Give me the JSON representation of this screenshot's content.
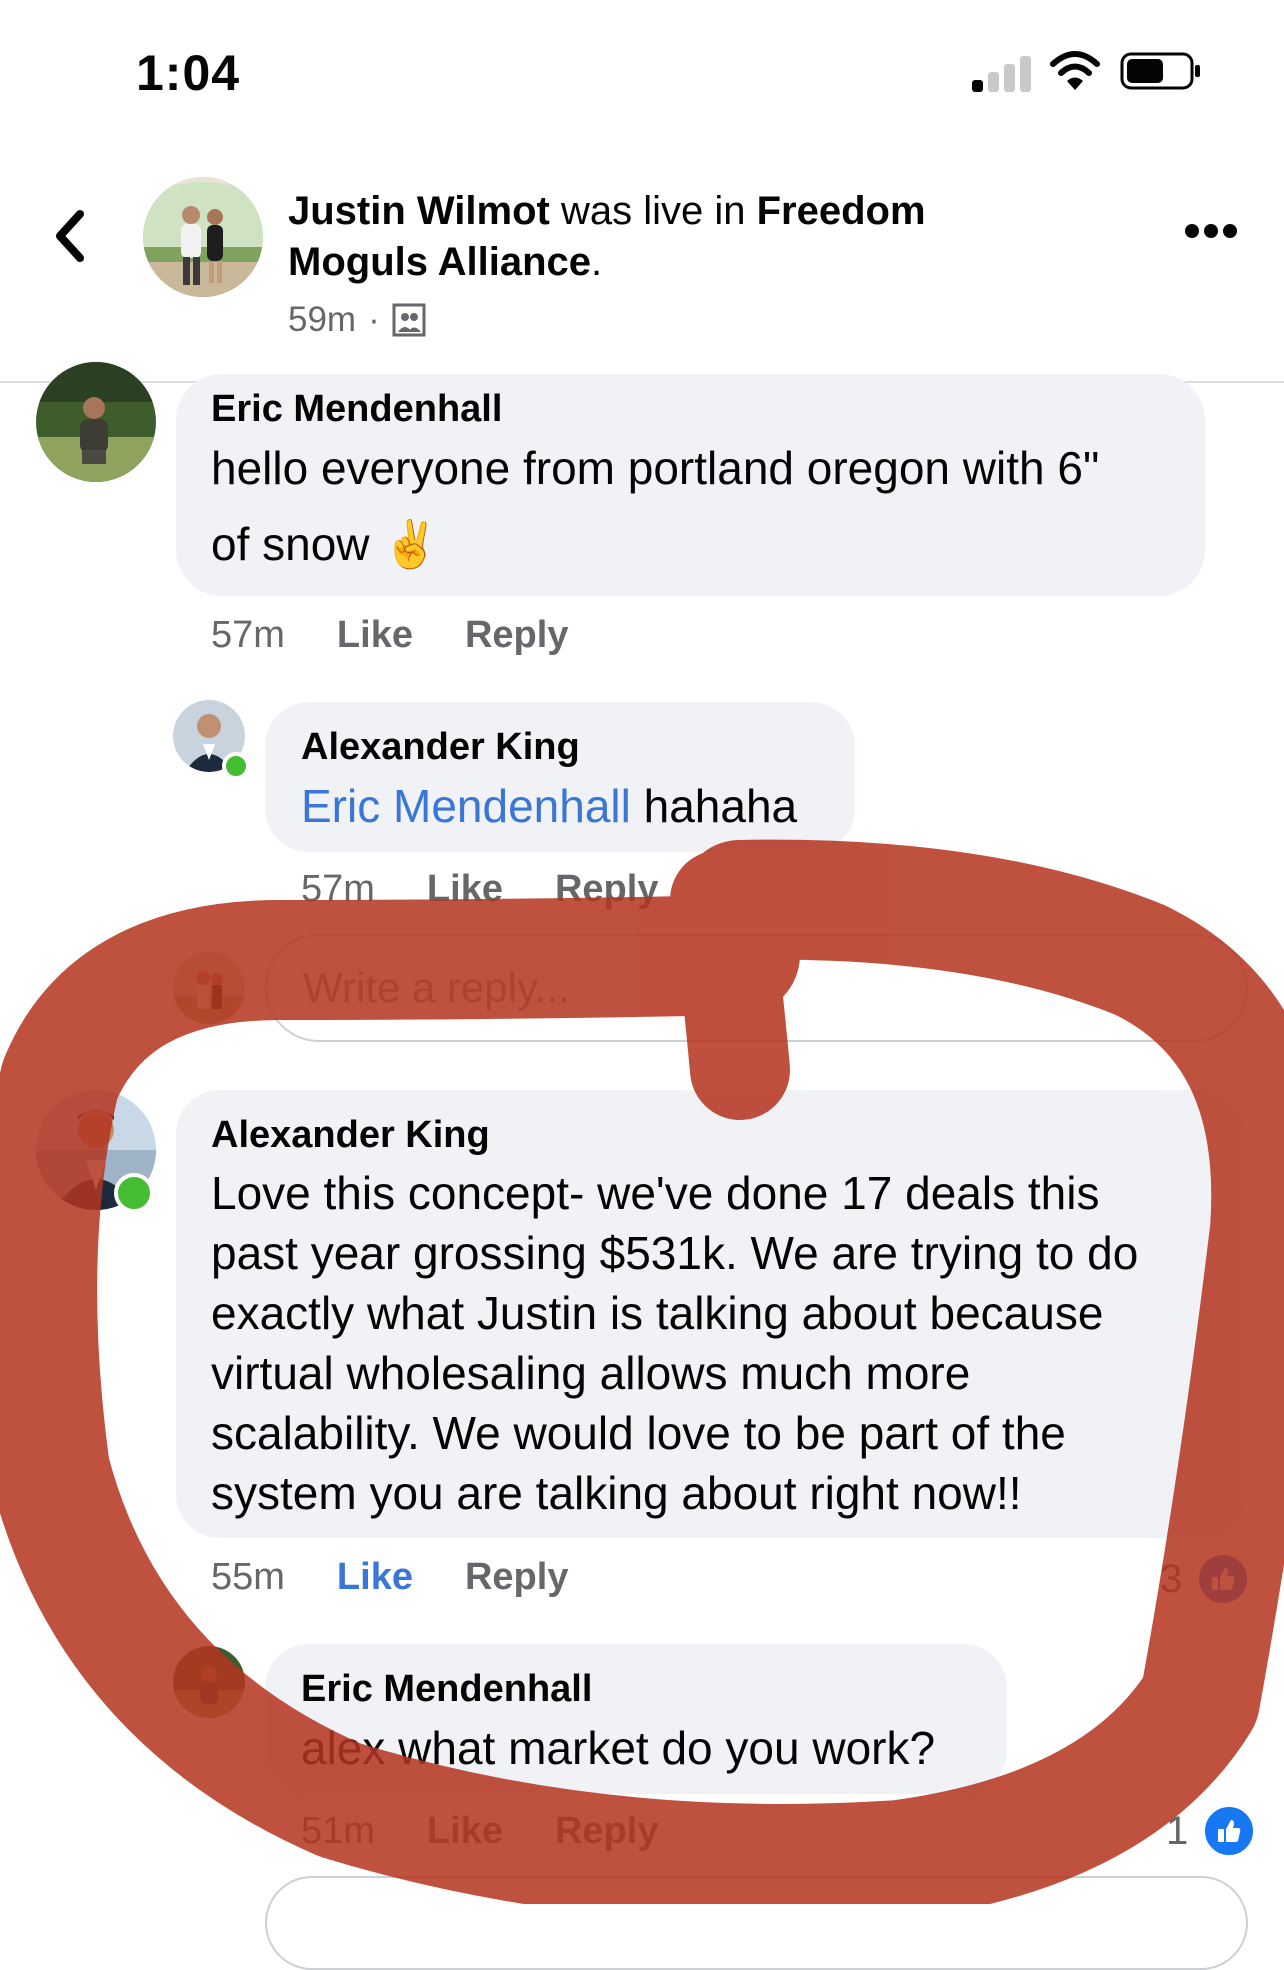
{
  "status_bar": {
    "time": "1:04"
  },
  "header": {
    "author": "Justin Wilmot",
    "connector": " was live in ",
    "group": "Freedom Moguls Alliance",
    "suffix": ".",
    "time": "59m",
    "separator": "·"
  },
  "comments": [
    {
      "name": "Eric Mendenhall",
      "text_line1": "hello everyone from portland oregon with 6\"",
      "text_line2": "of snow",
      "emoji": "✌️",
      "time": "57m",
      "like_label": "Like",
      "reply_label": "Reply"
    },
    {
      "name": "Alexander King",
      "mention": "Eric Mendenhall",
      "text": " hahaha",
      "time": "57m",
      "like_label": "Like",
      "reply_label": "Reply"
    },
    {
      "name": "Alexander King",
      "lines": [
        "Love this concept- we've done 17 deals this",
        "past year grossing $531k.  We are trying to do",
        "exactly what Justin is talking about because",
        "virtual wholesaling allows much more",
        "scalability.  We would love to be part of the",
        "system you are talking about right now!!"
      ],
      "time": "55m",
      "like_label": "Like",
      "reply_label": "Reply",
      "reaction_count": "3"
    },
    {
      "name": "Eric Mendenhall",
      "text": "alex what market do you work?",
      "time": "51m",
      "like_label": "Like",
      "reply_label": "Reply",
      "reaction_count": "1"
    }
  ],
  "reply_input": {
    "placeholder": "Write a reply..."
  },
  "icons": {
    "back": "chevron-left-icon",
    "more": "more-options-icon",
    "audience": "group-audience-icon",
    "like_reaction": "thumbs-up-icon"
  },
  "colors": {
    "accent_blue": "#1877f2",
    "link_blue": "#3a76d6",
    "bubble_gray": "#f0f2f5",
    "annotation_red": "#b5341f",
    "online_green": "#44bd32"
  }
}
